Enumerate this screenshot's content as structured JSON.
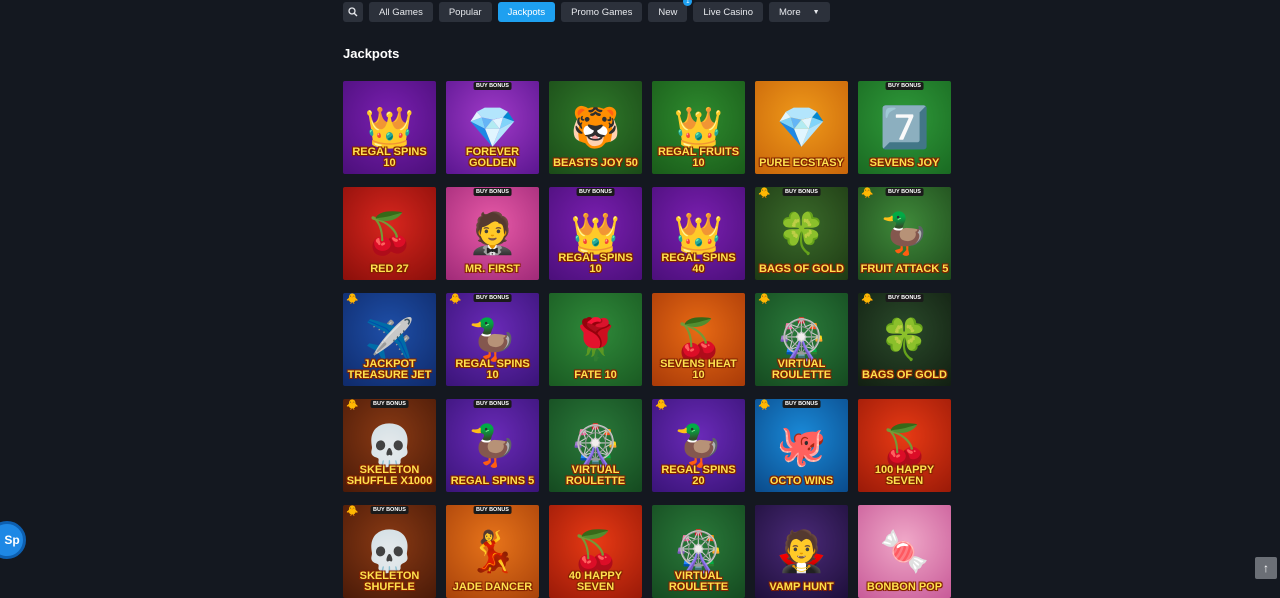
{
  "filters": {
    "search_icon": "search-icon",
    "chips": [
      {
        "label": "All Games",
        "active": false
      },
      {
        "label": "Popular",
        "active": false
      },
      {
        "label": "Jackpots",
        "active": true
      },
      {
        "label": "Promo Games",
        "active": false
      },
      {
        "label": "New",
        "active": false,
        "badge": "1"
      },
      {
        "label": "Live Casino",
        "active": false
      },
      {
        "label": "More",
        "active": false,
        "dropdown": true
      }
    ]
  },
  "section_title": "Jackpots",
  "games": [
    {
      "name": "Regal Spins 10",
      "bg": "#7a1fb0",
      "bg2": "#4b0f7a",
      "icon": "👑",
      "buy_bonus": false,
      "duck": false
    },
    {
      "name": "Forever Golden",
      "bg": "#a03ac8",
      "bg2": "#5b1690",
      "icon": "💎",
      "buy_bonus": true,
      "duck": false
    },
    {
      "name": "Beasts Joy 50",
      "bg": "#2f7a2a",
      "bg2": "#1b4a18",
      "icon": "🐯",
      "buy_bonus": false,
      "duck": false
    },
    {
      "name": "Regal Fruits 10",
      "bg": "#2e8b2e",
      "bg2": "#1a5c1a",
      "icon": "👑",
      "buy_bonus": false,
      "duck": false
    },
    {
      "name": "Pure Ecstasy",
      "bg": "#f09a1a",
      "bg2": "#c8650a",
      "icon": "💎",
      "buy_bonus": false,
      "duck": false
    },
    {
      "name": "Sevens Joy",
      "bg": "#2f9a3a",
      "bg2": "#1a6a22",
      "icon": "7️⃣",
      "buy_bonus": true,
      "duck": false
    },
    {
      "name": "Red 27",
      "bg": "#d8261e",
      "bg2": "#8a0f0a",
      "icon": "🍒",
      "buy_bonus": false,
      "duck": false
    },
    {
      "name": "Mr. First",
      "bg": "#e85aa8",
      "bg2": "#a02a78",
      "icon": "🤵",
      "buy_bonus": true,
      "duck": false
    },
    {
      "name": "Regal Spins 10",
      "bg": "#7a1fb0",
      "bg2": "#4b0f7a",
      "icon": "👑",
      "buy_bonus": true,
      "duck": false
    },
    {
      "name": "Regal Spins 40",
      "bg": "#7a1fb0",
      "bg2": "#4b0f7a",
      "icon": "👑",
      "buy_bonus": false,
      "duck": false
    },
    {
      "name": "Bags of Gold",
      "bg": "#3a6a2a",
      "bg2": "#1e3a14",
      "icon": "🍀",
      "buy_bonus": true,
      "duck": true
    },
    {
      "name": "Fruit Attack 5",
      "bg": "#3f8a3a",
      "bg2": "#1f4a1c",
      "icon": "🦆",
      "buy_bonus": true,
      "duck": true
    },
    {
      "name": "Jackpot Treasure Jet",
      "bg": "#1e4fa8",
      "bg2": "#0f2a6a",
      "icon": "✈️",
      "buy_bonus": false,
      "duck": true
    },
    {
      "name": "Regal Spins 10",
      "bg": "#6a2ab8",
      "bg2": "#3a1478",
      "icon": "🦆",
      "buy_bonus": true,
      "duck": true
    },
    {
      "name": "Fate 10",
      "bg": "#2f8a3a",
      "bg2": "#1a5a22",
      "icon": "🌹",
      "buy_bonus": false,
      "duck": false
    },
    {
      "name": "Sevens Heat 10",
      "bg": "#e86a14",
      "bg2": "#a83a08",
      "icon": "🍒",
      "buy_bonus": false,
      "duck": false
    },
    {
      "name": "Virtual Roulette",
      "bg": "#2a7a3a",
      "bg2": "#154a20",
      "icon": "🎡",
      "buy_bonus": false,
      "duck": true
    },
    {
      "name": "Bags of Gold",
      "bg": "#2a4a2a",
      "bg2": "#121f12",
      "icon": "🍀",
      "buy_bonus": true,
      "duck": true
    },
    {
      "name": "Skeleton Shuffle x1000",
      "bg": "#8a3a14",
      "bg2": "#4a1a08",
      "icon": "💀",
      "buy_bonus": true,
      "duck": true
    },
    {
      "name": "Regal Spins 5",
      "bg": "#6a2ab8",
      "bg2": "#3a1478",
      "icon": "🦆",
      "buy_bonus": true,
      "duck": false
    },
    {
      "name": "Virtual Roulette",
      "bg": "#2a7a3a",
      "bg2": "#154a20",
      "icon": "🎡",
      "buy_bonus": false,
      "duck": false
    },
    {
      "name": "Regal Spins 20",
      "bg": "#6a2ab8",
      "bg2": "#3a1478",
      "icon": "🦆",
      "buy_bonus": false,
      "duck": true
    },
    {
      "name": "Octo Wins",
      "bg": "#1a8ad8",
      "bg2": "#0a4a8a",
      "icon": "🐙",
      "buy_bonus": true,
      "duck": true
    },
    {
      "name": "100 Happy Seven",
      "bg": "#e83a14",
      "bg2": "#9a1a08",
      "icon": "🍒",
      "buy_bonus": false,
      "duck": false
    },
    {
      "name": "Skeleton Shuffle",
      "bg": "#8a3a14",
      "bg2": "#4a1a08",
      "icon": "💀",
      "buy_bonus": true,
      "duck": true
    },
    {
      "name": "Jade Dancer",
      "bg": "#e8741a",
      "bg2": "#a8420a",
      "icon": "💃",
      "buy_bonus": true,
      "duck": false
    },
    {
      "name": "40 Happy Seven",
      "bg": "#e83a14",
      "bg2": "#9a1a08",
      "icon": "🍒",
      "buy_bonus": false,
      "duck": false
    },
    {
      "name": "Virtual Roulette",
      "bg": "#2a7a3a",
      "bg2": "#154a20",
      "icon": "🎡",
      "buy_bonus": false,
      "duck": false
    },
    {
      "name": "Vamp Hunt",
      "bg": "#4a2a78",
      "bg2": "#1e0f3a",
      "icon": "🧛",
      "buy_bonus": false,
      "duck": false
    },
    {
      "name": "Bonbon Pop",
      "bg": "#f0a8c8",
      "bg2": "#c85a98",
      "icon": "🍬",
      "buy_bonus": false,
      "duck": false
    }
  ],
  "floating": {
    "chat_label": "Sp",
    "scroll_top": "↑"
  }
}
